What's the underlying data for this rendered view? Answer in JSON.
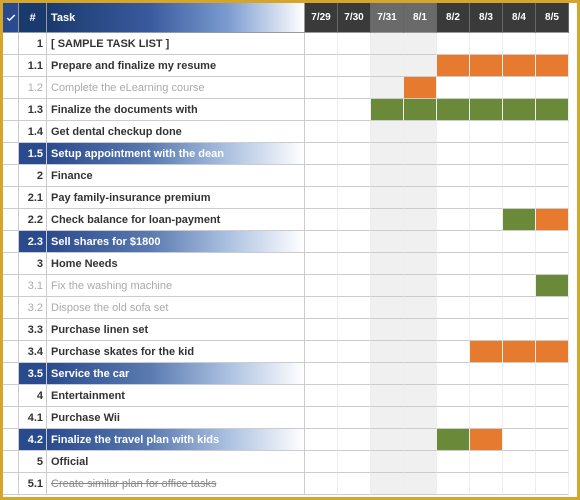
{
  "header": {
    "check": "✓",
    "num": "#",
    "task": "Task",
    "dates": [
      "7/29",
      "7/30",
      "7/31",
      "8/1",
      "8/2",
      "8/3",
      "8/4",
      "8/5"
    ],
    "selected_dates": [
      2,
      3
    ]
  },
  "rows": [
    {
      "num": "1",
      "task": "[ SAMPLE TASK LIST ]",
      "style": "bold",
      "bars": []
    },
    {
      "num": "1.1",
      "task": "Prepare and finalize my resume",
      "style": "bold",
      "bars": [
        {
          "c": "orange",
          "d": [
            4,
            5,
            6,
            7
          ]
        }
      ]
    },
    {
      "num": "1.2",
      "task": "Complete the eLearning course",
      "style": "grey",
      "bars": [
        {
          "c": "orange",
          "d": [
            3
          ]
        }
      ]
    },
    {
      "num": "1.3",
      "task": "Finalize the documents with",
      "style": "bold",
      "bars": [
        {
          "c": "green",
          "d": [
            2,
            3,
            4,
            5,
            6,
            7
          ]
        }
      ]
    },
    {
      "num": "1.4",
      "task": "Get dental checkup done",
      "style": "bold",
      "bars": []
    },
    {
      "num": "1.5",
      "task": "Setup appointment with the dean",
      "style": "hl",
      "bars": []
    },
    {
      "num": "2",
      "task": "Finance",
      "style": "bold",
      "bars": []
    },
    {
      "num": "2.1",
      "task": "Pay family-insurance premium",
      "style": "bold",
      "bars": []
    },
    {
      "num": "2.2",
      "task": "Check balance for loan-payment",
      "style": "bold",
      "bars": [
        {
          "c": "green",
          "d": [
            6
          ]
        },
        {
          "c": "orange",
          "d": [
            7
          ]
        }
      ]
    },
    {
      "num": "2.3",
      "task": "Sell shares for $1800",
      "style": "hl",
      "bars": []
    },
    {
      "num": "3",
      "task": "Home Needs",
      "style": "bold",
      "bars": []
    },
    {
      "num": "3.1",
      "task": "Fix the washing machine",
      "style": "grey",
      "bars": [
        {
          "c": "green",
          "d": [
            7
          ]
        }
      ]
    },
    {
      "num": "3.2",
      "task": "Dispose the old sofa set",
      "style": "grey",
      "bars": []
    },
    {
      "num": "3.3",
      "task": "Purchase linen set",
      "style": "bold",
      "bars": []
    },
    {
      "num": "3.4",
      "task": "Purchase skates for the kid",
      "style": "bold",
      "bars": [
        {
          "c": "orange",
          "d": [
            5,
            6,
            7
          ]
        }
      ]
    },
    {
      "num": "3.5",
      "task": "Service the car",
      "style": "hl",
      "bars": []
    },
    {
      "num": "4",
      "task": "Entertainment",
      "style": "bold",
      "bars": []
    },
    {
      "num": "4.1",
      "task": "Purchase Wii",
      "style": "bold",
      "bars": []
    },
    {
      "num": "4.2",
      "task": "Finalize the travel plan with kids",
      "style": "hl",
      "bars": [
        {
          "c": "green",
          "d": [
            4
          ]
        },
        {
          "c": "orange",
          "d": [
            5
          ]
        }
      ]
    },
    {
      "num": "5",
      "task": "Official",
      "style": "bold",
      "bars": []
    },
    {
      "num": "5.1",
      "task": "Create similar plan for office tasks",
      "style": "strike",
      "bars": []
    }
  ],
  "chart_data": {
    "type": "gantt",
    "title": "Sample Task List",
    "date_columns": [
      "7/29",
      "7/30",
      "7/31",
      "8/1",
      "8/2",
      "8/3",
      "8/4",
      "8/5"
    ],
    "tasks": [
      {
        "id": "1.1",
        "name": "Prepare and finalize my resume",
        "color": "orange",
        "dates": [
          "8/2",
          "8/3",
          "8/4",
          "8/5"
        ]
      },
      {
        "id": "1.2",
        "name": "Complete the eLearning course",
        "color": "orange",
        "dates": [
          "8/1"
        ]
      },
      {
        "id": "1.3",
        "name": "Finalize the documents with",
        "color": "green",
        "dates": [
          "7/31",
          "8/1",
          "8/2",
          "8/3",
          "8/4",
          "8/5"
        ]
      },
      {
        "id": "2.2",
        "name": "Check balance for loan-payment",
        "color": "green",
        "dates": [
          "8/4"
        ]
      },
      {
        "id": "2.2",
        "name": "Check balance for loan-payment",
        "color": "orange",
        "dates": [
          "8/5"
        ]
      },
      {
        "id": "3.1",
        "name": "Fix the washing machine",
        "color": "green",
        "dates": [
          "8/5"
        ]
      },
      {
        "id": "3.4",
        "name": "Purchase skates for the kid",
        "color": "orange",
        "dates": [
          "8/3",
          "8/4",
          "8/5"
        ]
      },
      {
        "id": "4.2",
        "name": "Finalize the travel plan with kids",
        "color": "green",
        "dates": [
          "8/2"
        ]
      },
      {
        "id": "4.2",
        "name": "Finalize the travel plan with kids",
        "color": "orange",
        "dates": [
          "8/3"
        ]
      }
    ],
    "legend": {
      "orange": "#e67a2e",
      "green": "#6a8a3a"
    }
  }
}
